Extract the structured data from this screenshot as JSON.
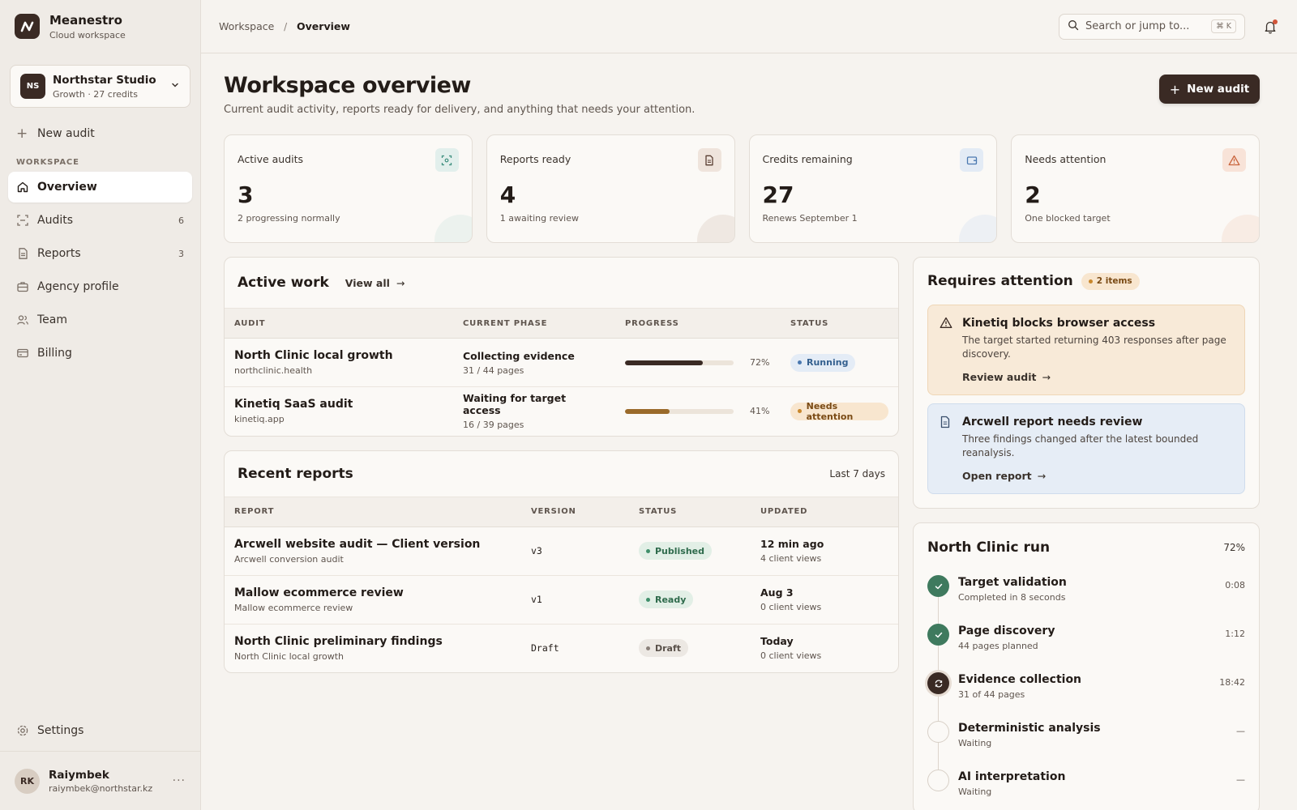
{
  "brand": {
    "name": "Meanestro",
    "subtitle": "Cloud workspace"
  },
  "workspace_switcher": {
    "initials": "NS",
    "name": "Northstar Studio",
    "plan": "Growth · 27 credits"
  },
  "sidebar": {
    "new_audit_label": "New audit",
    "section_heading": "WORKSPACE",
    "items": [
      {
        "label": "Overview",
        "icon": "home-icon",
        "count": ""
      },
      {
        "label": "Audits",
        "icon": "scan-icon",
        "count": "6"
      },
      {
        "label": "Reports",
        "icon": "document-icon",
        "count": "3"
      },
      {
        "label": "Agency profile",
        "icon": "briefcase-icon",
        "count": ""
      },
      {
        "label": "Team",
        "icon": "users-icon",
        "count": ""
      },
      {
        "label": "Billing",
        "icon": "credit-card-icon",
        "count": ""
      }
    ],
    "settings_label": "Settings"
  },
  "user": {
    "initials": "RK",
    "name": "Raiymbek",
    "email": "raiymbek@northstar.kz"
  },
  "topbar": {
    "breadcrumb_root": "Workspace",
    "breadcrumb_separator": "/",
    "breadcrumb_current": "Overview",
    "search_placeholder": "Search or jump to...",
    "search_shortcut": "⌘ K"
  },
  "page": {
    "title": "Workspace overview",
    "subtitle": "Current audit activity, reports ready for delivery, and anything that needs your attention.",
    "new_audit_button": "New audit"
  },
  "stats": [
    {
      "label": "Active audits",
      "value": "3",
      "note": "2 progressing normally",
      "icon": "scan-icon",
      "accent": "#3f8f7f"
    },
    {
      "label": "Reports ready",
      "value": "4",
      "note": "1 awaiting review",
      "icon": "document-icon",
      "accent": "#7a5a48"
    },
    {
      "label": "Credits remaining",
      "value": "27",
      "note": "Renews September 1",
      "icon": "wallet-icon",
      "accent": "#4a78b0"
    },
    {
      "label": "Needs attention",
      "value": "2",
      "note": "One blocked target",
      "icon": "warning-icon",
      "accent": "#c9653d"
    }
  ],
  "active_work": {
    "title": "Active work",
    "view_all": "View all",
    "columns": [
      "AUDIT",
      "CURRENT PHASE",
      "PROGRESS",
      "STATUS"
    ],
    "rows": [
      {
        "name": "North Clinic local growth",
        "domain": "northclinic.health",
        "phase": "Collecting evidence",
        "phase_detail": "31 / 44 pages",
        "progress": 0.72,
        "progress_label": "72%",
        "status": "Running",
        "status_kind": "running"
      },
      {
        "name": "Kinetiq SaaS audit",
        "domain": "kinetiq.app",
        "phase": "Waiting for target access",
        "phase_detail": "16 / 39 pages",
        "progress": 0.41,
        "progress_label": "41%",
        "status": "Needs attention",
        "status_kind": "attention"
      }
    ]
  },
  "recent_reports": {
    "title": "Recent reports",
    "range": "Last 7 days",
    "columns": [
      "REPORT",
      "VERSION",
      "STATUS",
      "UPDATED"
    ],
    "rows": [
      {
        "name": "Arcwell website audit — Client version",
        "source": "Arcwell conversion audit",
        "version": "v3",
        "status": "Published",
        "status_kind": "published",
        "updated": "12 min ago",
        "views": "4 client views"
      },
      {
        "name": "Mallow ecommerce review",
        "source": "Mallow ecommerce review",
        "version": "v1",
        "status": "Ready",
        "status_kind": "ready",
        "updated": "Aug 3",
        "views": "0 client views"
      },
      {
        "name": "North Clinic preliminary findings",
        "source": "North Clinic local growth",
        "version": "Draft",
        "status": "Draft",
        "status_kind": "draft",
        "updated": "Today",
        "views": "0 client views"
      }
    ]
  },
  "attention": {
    "title": "Requires attention",
    "count_label": "2 items",
    "items": [
      {
        "title": "Kinetiq blocks browser access",
        "description": "The target started returning 403 responses after page discovery.",
        "link": "Review audit",
        "kind": "warning"
      },
      {
        "title": "Arcwell report needs review",
        "description": "Three findings changed after the latest bounded reanalysis.",
        "link": "Open report",
        "kind": "info"
      }
    ]
  },
  "run": {
    "title": "North Clinic run",
    "progress_label": "72%",
    "steps": [
      {
        "title": "Target validation",
        "detail": "Completed in 8 seconds",
        "time": "0:08",
        "state": "done"
      },
      {
        "title": "Page discovery",
        "detail": "44 pages planned",
        "time": "1:12",
        "state": "done"
      },
      {
        "title": "Evidence collection",
        "detail": "31 of 44 pages",
        "time": "18:42",
        "state": "active"
      },
      {
        "title": "Deterministic analysis",
        "detail": "Waiting",
        "time": "—",
        "state": "pending"
      },
      {
        "title": "AI interpretation",
        "detail": "Waiting",
        "time": "—",
        "state": "pending"
      }
    ]
  },
  "colors": {
    "accent": "#3a2a24",
    "running": "#4a78b0",
    "attention": "#c8872c",
    "success": "#3f8f6a",
    "progress_dark": "#3a2a24",
    "progress_amber": "#9a6a2a"
  }
}
